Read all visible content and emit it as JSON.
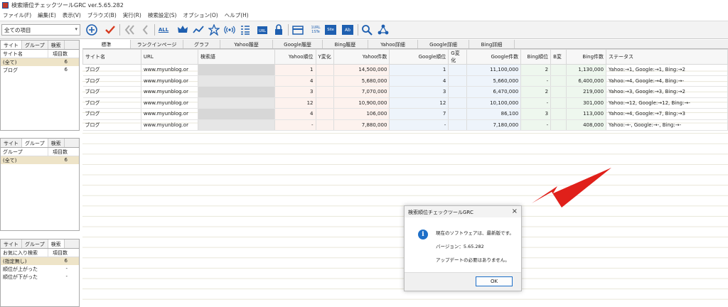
{
  "window": {
    "title": "検索順位チェックツールGRC  ver.5.65.282"
  },
  "menu": [
    "ファイル(F)",
    "編集(E)",
    "表示(V)",
    "ブラウズ(B)",
    "実行(R)",
    "検索設定(S)",
    "オプション(O)",
    "ヘルプ(H)"
  ],
  "filter_combo": {
    "value": "全ての項目"
  },
  "toolbar_texts": {
    "all": "ALL",
    "url1st": "1URL",
    "url1st_sub": "1STe",
    "site1st": "Site",
    "ab": "Ab"
  },
  "site_panel": {
    "tabs": [
      "サイト",
      "グループ",
      "検索"
    ],
    "headers": [
      "サイト名",
      "項目数"
    ],
    "rows": [
      {
        "name": "(全て)",
        "count": "6"
      },
      {
        "name": "ブログ",
        "count": "6"
      }
    ]
  },
  "group_panel": {
    "tabs": [
      "サイト",
      "グループ",
      "検索"
    ],
    "headers": [
      "グループ",
      "項目数"
    ],
    "rows": [
      {
        "name": "(全て)",
        "count": "6"
      }
    ]
  },
  "search_panel": {
    "tabs": [
      "サイト",
      "グループ",
      "検索"
    ],
    "headers": [
      "お気に入り検索",
      "項目数"
    ],
    "rows": [
      {
        "name": "(指定無し)",
        "count": "6"
      },
      {
        "name": "順位が上がった",
        "count": "-"
      },
      {
        "name": "順位が下がった",
        "count": "-"
      }
    ]
  },
  "main_tabs": [
    "標準",
    "ランクインページ",
    "グラフ",
    "Yahoo履歴",
    "Google履歴",
    "Bing履歴",
    "Yahoo詳細",
    "Google詳細",
    "Bing詳細"
  ],
  "table": {
    "headers": [
      "サイト名",
      "URL",
      "検索語",
      "Yahoo順位",
      "Y変化",
      "Yahoo件数",
      "Google順位",
      "G変化",
      "Google件数",
      "Bing順位",
      "B変",
      "Bing件数",
      "ステータス"
    ],
    "rows": [
      {
        "site": "ブログ",
        "url": "www.myunblog.or",
        "keyword": "",
        "y_rank": "1",
        "y_change": "",
        "y_count": "14,500,000",
        "g_rank": "1",
        "g_change": "",
        "g_count": "11,100,000",
        "b_rank": "2",
        "b_change": "",
        "b_count": "1,130,000",
        "status": "Yahoo:→1, Google:→1, Bing:→2"
      },
      {
        "site": "ブログ",
        "url": "www.myunblog.or",
        "keyword": "",
        "y_rank": "4",
        "y_change": "",
        "y_count": "5,680,000",
        "g_rank": "4",
        "g_change": "",
        "g_count": "5,660,000",
        "b_rank": "-",
        "b_change": "",
        "b_count": "6,400,000",
        "status": "Yahoo:→4, Google:→4, Bing:→-"
      },
      {
        "site": "ブログ",
        "url": "www.myunblog.or",
        "keyword": "",
        "y_rank": "3",
        "y_change": "",
        "y_count": "7,070,000",
        "g_rank": "3",
        "g_change": "",
        "g_count": "6,470,000",
        "b_rank": "2",
        "b_change": "",
        "b_count": "219,000",
        "status": "Yahoo:→3, Google:→3, Bing:→2"
      },
      {
        "site": "ブログ",
        "url": "www.myunblog.or",
        "keyword": "",
        "y_rank": "12",
        "y_change": "",
        "y_count": "10,900,000",
        "g_rank": "12",
        "g_change": "",
        "g_count": "10,100,000",
        "b_rank": "-",
        "b_change": "",
        "b_count": "301,000",
        "status": "Yahoo:→12, Google:→12, Bing:→-"
      },
      {
        "site": "ブログ",
        "url": "www.myunblog.or",
        "keyword": "",
        "y_rank": "4",
        "y_change": "",
        "y_count": "106,000",
        "g_rank": "7",
        "g_change": "",
        "g_count": "86,100",
        "b_rank": "3",
        "b_change": "",
        "b_count": "113,000",
        "status": "Yahoo:→4, Google:→7, Bing:→3"
      },
      {
        "site": "ブログ",
        "url": "www.myunblog.or",
        "keyword": "",
        "y_rank": "-",
        "y_change": "",
        "y_count": "7,880,000",
        "g_rank": "-",
        "g_change": "",
        "g_count": "7,180,000",
        "b_rank": "-",
        "b_change": "",
        "b_count": "408,000",
        "status": "Yahoo:→-, Google:→-, Bing:→-"
      }
    ]
  },
  "dialog": {
    "title": "検索順位チェックツールGRC",
    "line1": "現在のソフトウェアは、最新版です。",
    "line2": "バージョン：5.65.282",
    "line3": "アップデートの必要はありません。",
    "ok": "OK"
  },
  "colors": {
    "accent": "#1e6fc8",
    "arrow": "#e0201a",
    "selected_row": "#eee4c8"
  }
}
